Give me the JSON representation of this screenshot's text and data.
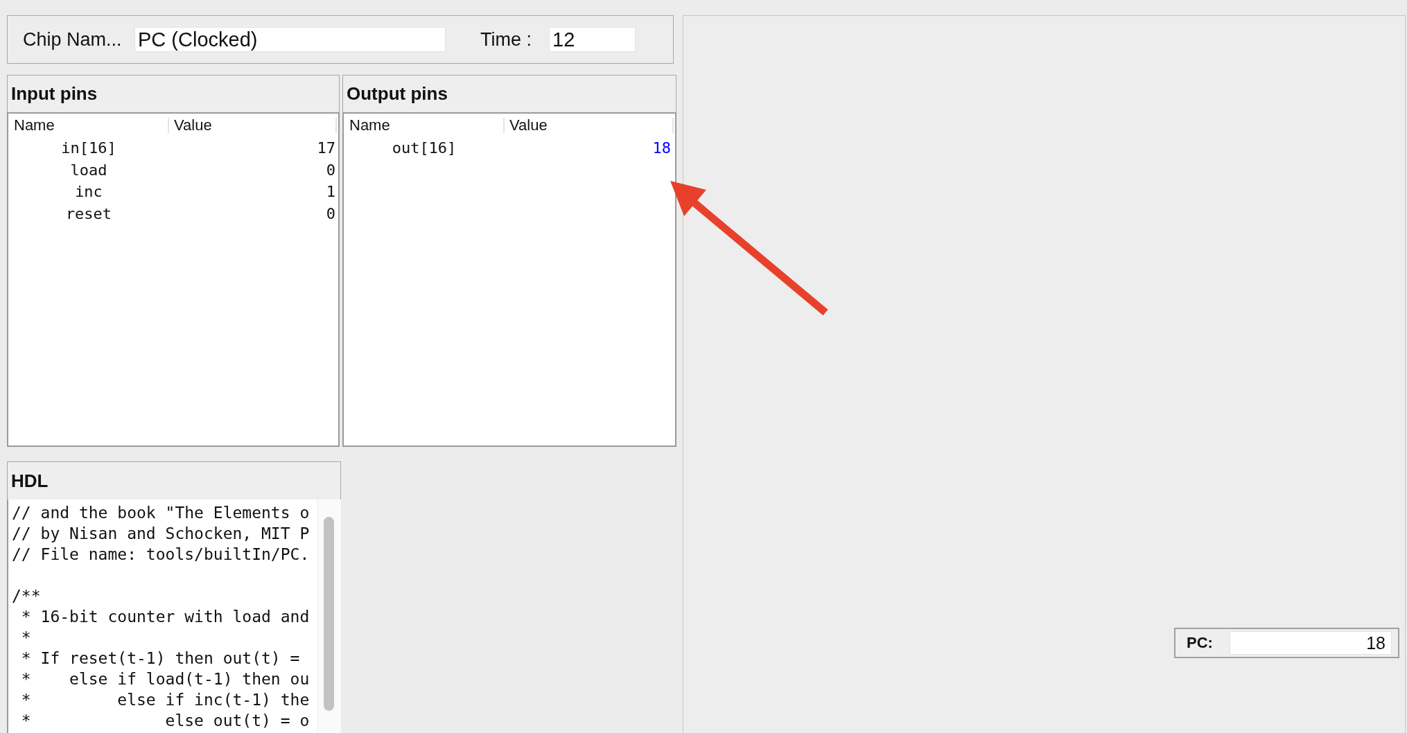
{
  "header": {
    "chip_name_label": "Chip Nam...",
    "chip_name": "PC (Clocked)",
    "time_label": "Time :",
    "time": "12"
  },
  "input_pins": {
    "title": "Input pins",
    "columns": [
      "Name",
      "Value"
    ],
    "rows": [
      {
        "name": "in[16]",
        "value": "17",
        "changed": false
      },
      {
        "name": "load",
        "value": "0",
        "changed": false
      },
      {
        "name": "inc",
        "value": "1",
        "changed": false
      },
      {
        "name": "reset",
        "value": "0",
        "changed": false
      }
    ]
  },
  "output_pins": {
    "title": "Output pins",
    "columns": [
      "Name",
      "Value"
    ],
    "rows": [
      {
        "name": "out[16]",
        "value": "18",
        "changed": true
      }
    ]
  },
  "hdl": {
    "title": "HDL",
    "code": "// and the book \"The Elements o\n// by Nisan and Schocken, MIT P\n// File name: tools/builtIn/PC.\n\n/**\n * 16-bit counter with load and\n *\n * If reset(t-1) then out(t) =\n *    else if load(t-1) then ou\n *         else if inc(t-1) the\n *              else out(t) = o"
  },
  "pc_display": {
    "label": "PC:",
    "value": "18"
  }
}
